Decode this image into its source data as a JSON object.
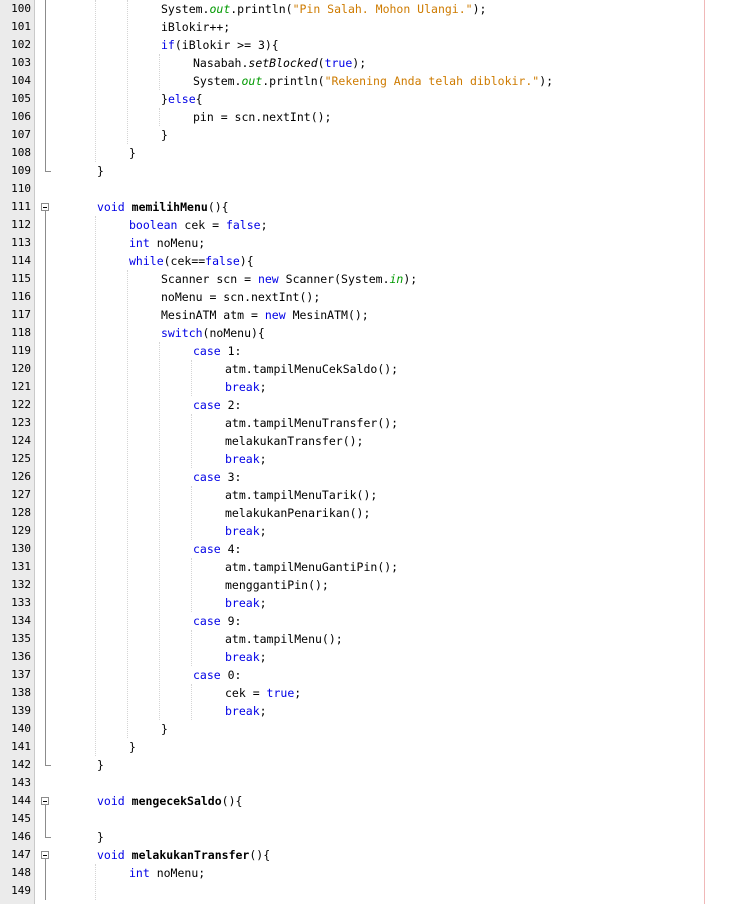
{
  "editor": {
    "lines": [
      {
        "n": "100",
        "indent": 3,
        "tokens": [
          {
            "t": "System."
          },
          {
            "t": "out",
            "c": "fld"
          },
          {
            "t": ".println("
          },
          {
            "t": "\"Pin Salah. Mohon Ulangi.\"",
            "c": "str"
          },
          {
            "t": ");"
          }
        ]
      },
      {
        "n": "101",
        "indent": 3,
        "tokens": [
          {
            "t": "iBlokir++;"
          }
        ]
      },
      {
        "n": "102",
        "indent": 3,
        "tokens": [
          {
            "t": "if",
            "c": "kw"
          },
          {
            "t": "(iBlokir >= 3){"
          }
        ]
      },
      {
        "n": "103",
        "indent": 4,
        "tokens": [
          {
            "t": "Nasabah."
          },
          {
            "t": "setBlocked",
            "c": "it"
          },
          {
            "t": "("
          },
          {
            "t": "true",
            "c": "kw"
          },
          {
            "t": ");"
          }
        ]
      },
      {
        "n": "104",
        "indent": 4,
        "tokens": [
          {
            "t": "System."
          },
          {
            "t": "out",
            "c": "fld"
          },
          {
            "t": ".println("
          },
          {
            "t": "\"Rekening Anda telah diblokir.\"",
            "c": "str"
          },
          {
            "t": ");"
          }
        ]
      },
      {
        "n": "105",
        "indent": 3,
        "tokens": [
          {
            "t": "}"
          },
          {
            "t": "else",
            "c": "kw"
          },
          {
            "t": "{"
          }
        ]
      },
      {
        "n": "106",
        "indent": 4,
        "tokens": [
          {
            "t": "pin = scn.nextInt();"
          }
        ]
      },
      {
        "n": "107",
        "indent": 3,
        "tokens": [
          {
            "t": "}"
          }
        ]
      },
      {
        "n": "108",
        "indent": 2,
        "tokens": [
          {
            "t": "}"
          }
        ]
      },
      {
        "n": "109",
        "indent": 1,
        "tokens": [
          {
            "t": "}"
          }
        ]
      },
      {
        "n": "110",
        "indent": 0,
        "tokens": []
      },
      {
        "n": "111",
        "indent": 1,
        "tokens": [
          {
            "t": "void",
            "c": "kw"
          },
          {
            "t": " "
          },
          {
            "t": "memilihMenu",
            "c": "fn"
          },
          {
            "t": "(){"
          }
        ]
      },
      {
        "n": "112",
        "indent": 2,
        "tokens": [
          {
            "t": "boolean",
            "c": "kw"
          },
          {
            "t": " cek = "
          },
          {
            "t": "false",
            "c": "kw"
          },
          {
            "t": ";"
          }
        ]
      },
      {
        "n": "113",
        "indent": 2,
        "tokens": [
          {
            "t": "int",
            "c": "kw"
          },
          {
            "t": " noMenu;"
          }
        ]
      },
      {
        "n": "114",
        "indent": 2,
        "tokens": [
          {
            "t": "while",
            "c": "kw"
          },
          {
            "t": "(cek=="
          },
          {
            "t": "false",
            "c": "kw"
          },
          {
            "t": "){"
          }
        ]
      },
      {
        "n": "115",
        "indent": 3,
        "tokens": [
          {
            "t": "Scanner scn = "
          },
          {
            "t": "new",
            "c": "kw"
          },
          {
            "t": " Scanner(System."
          },
          {
            "t": "in",
            "c": "fld"
          },
          {
            "t": ");"
          }
        ]
      },
      {
        "n": "116",
        "indent": 3,
        "tokens": [
          {
            "t": "noMenu = scn.nextInt();"
          }
        ]
      },
      {
        "n": "117",
        "indent": 3,
        "tokens": [
          {
            "t": "MesinATM atm = "
          },
          {
            "t": "new",
            "c": "kw"
          },
          {
            "t": " MesinATM();"
          }
        ]
      },
      {
        "n": "118",
        "indent": 3,
        "tokens": [
          {
            "t": "switch",
            "c": "kw"
          },
          {
            "t": "(noMenu){"
          }
        ]
      },
      {
        "n": "119",
        "indent": 4,
        "tokens": [
          {
            "t": "case",
            "c": "kw"
          },
          {
            "t": " 1:"
          }
        ]
      },
      {
        "n": "120",
        "indent": 5,
        "tokens": [
          {
            "t": "atm.tampilMenuCekSaldo();"
          }
        ]
      },
      {
        "n": "121",
        "indent": 5,
        "tokens": [
          {
            "t": "break",
            "c": "kw"
          },
          {
            "t": ";"
          }
        ]
      },
      {
        "n": "122",
        "indent": 4,
        "tokens": [
          {
            "t": "case",
            "c": "kw"
          },
          {
            "t": " 2:"
          }
        ]
      },
      {
        "n": "123",
        "indent": 5,
        "tokens": [
          {
            "t": "atm.tampilMenuTransfer();"
          }
        ]
      },
      {
        "n": "124",
        "indent": 5,
        "tokens": [
          {
            "t": "melakukanTransfer();"
          }
        ]
      },
      {
        "n": "125",
        "indent": 5,
        "tokens": [
          {
            "t": "break",
            "c": "kw"
          },
          {
            "t": ";"
          }
        ]
      },
      {
        "n": "126",
        "indent": 4,
        "tokens": [
          {
            "t": "case",
            "c": "kw"
          },
          {
            "t": " 3:"
          }
        ]
      },
      {
        "n": "127",
        "indent": 5,
        "tokens": [
          {
            "t": "atm.tampilMenuTarik();"
          }
        ]
      },
      {
        "n": "128",
        "indent": 5,
        "tokens": [
          {
            "t": "melakukanPenarikan();"
          }
        ]
      },
      {
        "n": "129",
        "indent": 5,
        "tokens": [
          {
            "t": "break",
            "c": "kw"
          },
          {
            "t": ";"
          }
        ]
      },
      {
        "n": "130",
        "indent": 4,
        "tokens": [
          {
            "t": "case",
            "c": "kw"
          },
          {
            "t": " 4:"
          }
        ]
      },
      {
        "n": "131",
        "indent": 5,
        "tokens": [
          {
            "t": "atm.tampilMenuGantiPin();"
          }
        ]
      },
      {
        "n": "132",
        "indent": 5,
        "tokens": [
          {
            "t": "menggantiPin();"
          }
        ]
      },
      {
        "n": "133",
        "indent": 5,
        "tokens": [
          {
            "t": "break",
            "c": "kw"
          },
          {
            "t": ";"
          }
        ]
      },
      {
        "n": "134",
        "indent": 4,
        "tokens": [
          {
            "t": "case",
            "c": "kw"
          },
          {
            "t": " 9:"
          }
        ]
      },
      {
        "n": "135",
        "indent": 5,
        "tokens": [
          {
            "t": "atm.tampilMenu();"
          }
        ]
      },
      {
        "n": "136",
        "indent": 5,
        "tokens": [
          {
            "t": "break",
            "c": "kw"
          },
          {
            "t": ";"
          }
        ]
      },
      {
        "n": "137",
        "indent": 4,
        "tokens": [
          {
            "t": "case",
            "c": "kw"
          },
          {
            "t": " 0:"
          }
        ]
      },
      {
        "n": "138",
        "indent": 5,
        "tokens": [
          {
            "t": "cek = "
          },
          {
            "t": "true",
            "c": "kw"
          },
          {
            "t": ";"
          }
        ]
      },
      {
        "n": "139",
        "indent": 5,
        "tokens": [
          {
            "t": "break",
            "c": "kw"
          },
          {
            "t": ";"
          }
        ]
      },
      {
        "n": "140",
        "indent": 3,
        "tokens": [
          {
            "t": "}"
          }
        ]
      },
      {
        "n": "141",
        "indent": 2,
        "tokens": [
          {
            "t": "}"
          }
        ]
      },
      {
        "n": "142",
        "indent": 1,
        "tokens": [
          {
            "t": "}"
          }
        ]
      },
      {
        "n": "143",
        "indent": 0,
        "tokens": []
      },
      {
        "n": "144",
        "indent": 1,
        "tokens": [
          {
            "t": "void",
            "c": "kw"
          },
          {
            "t": " "
          },
          {
            "t": "mengecekSaldo",
            "c": "fn"
          },
          {
            "t": "(){"
          }
        ]
      },
      {
        "n": "145",
        "indent": 0,
        "tokens": []
      },
      {
        "n": "146",
        "indent": 1,
        "tokens": [
          {
            "t": "}"
          }
        ]
      },
      {
        "n": "147",
        "indent": 1,
        "tokens": [
          {
            "t": "void",
            "c": "kw"
          },
          {
            "t": " "
          },
          {
            "t": "melakukanTransfer",
            "c": "fn"
          },
          {
            "t": "(){"
          }
        ]
      },
      {
        "n": "148",
        "indent": 2,
        "tokens": [
          {
            "t": "int",
            "c": "kw"
          },
          {
            "t": " noMenu;"
          }
        ]
      },
      {
        "n": "149",
        "indent": 0,
        "tokens": []
      }
    ],
    "folds": [
      {
        "type": "end",
        "line": "109"
      },
      {
        "type": "start",
        "line": "111"
      },
      {
        "type": "end",
        "line": "142"
      },
      {
        "type": "start",
        "line": "144"
      },
      {
        "type": "end",
        "line": "146"
      },
      {
        "type": "start",
        "line": "147"
      }
    ]
  }
}
